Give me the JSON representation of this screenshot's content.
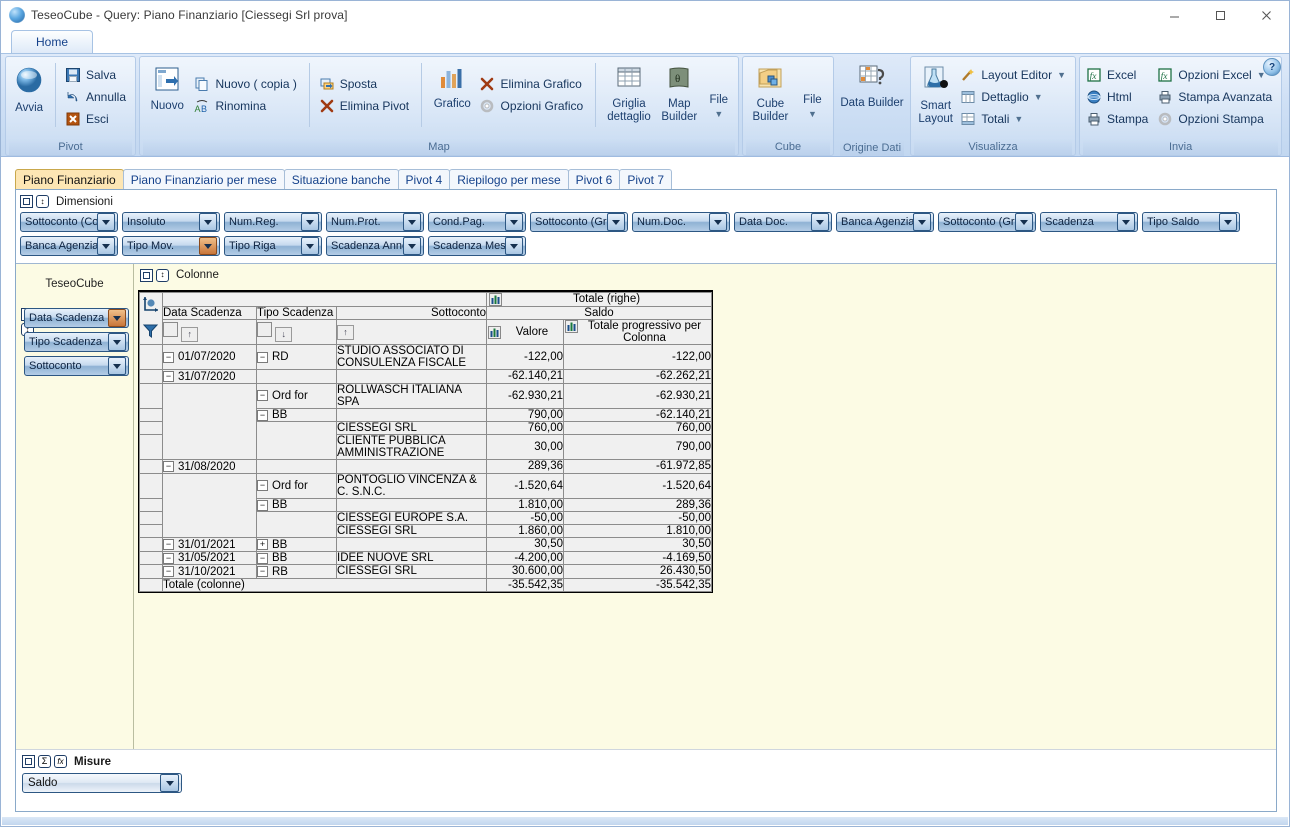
{
  "window": {
    "title": "TeseoCube - Query: Piano Finanziario [Ciessegi Srl prova]",
    "minimize": "minimize",
    "maximize": "maximize",
    "close": "close",
    "help": "?"
  },
  "ribbon": {
    "tabs": [
      {
        "label": "Home"
      }
    ],
    "groups": [
      {
        "name": "Pivot",
        "label": "Pivot",
        "big": [
          {
            "label": "Avvia",
            "icon": "sphere-icon"
          }
        ],
        "small": [
          {
            "label": "Salva",
            "icon": "save-icon"
          },
          {
            "label": "Annulla",
            "icon": "undo-icon"
          },
          {
            "label": "Esci",
            "icon": "exit-icon"
          }
        ]
      },
      {
        "name": "Map",
        "label": "Map",
        "big": [
          {
            "label": "Nuovo",
            "icon": "new-pivot-icon"
          }
        ],
        "small": [
          {
            "label": "Nuovo ( copia )",
            "icon": "copy-icon"
          },
          {
            "label": "Rinomina",
            "icon": "rename-icon"
          }
        ],
        "small2": [
          {
            "label": "Sposta",
            "icon": "move-icon"
          },
          {
            "label": "Elimina Pivot",
            "icon": "delete-icon"
          }
        ],
        "big2": [
          {
            "label": "Grafico",
            "icon": "chart-icon"
          }
        ],
        "small3": [
          {
            "label": "Elimina Grafico",
            "icon": "delete-icon"
          },
          {
            "label": "Opzioni Grafico",
            "icon": "gear-icon"
          }
        ],
        "big3": [
          {
            "label": "Griglia dettaglio",
            "icon": "grid-icon"
          },
          {
            "label": "Map Builder",
            "icon": "map-builder-icon"
          },
          {
            "label": "File",
            "icon": "file-dropdown-icon",
            "dropdown": true
          }
        ]
      },
      {
        "name": "Cube",
        "label": "Cube",
        "big": [
          {
            "label": "Cube Builder",
            "icon": "cube-builder-icon"
          },
          {
            "label": "File",
            "icon": "file-dropdown-icon",
            "dropdown": true
          }
        ]
      },
      {
        "name": "Origine Dati",
        "label": "Origine Dati",
        "big": [
          {
            "label": "Data Builder",
            "icon": "data-builder-icon"
          }
        ]
      },
      {
        "name": "Visualizza",
        "label": "Visualizza",
        "big": [
          {
            "label": "Smart Layout",
            "icon": "smart-layout-icon"
          }
        ],
        "small": [
          {
            "label": "Layout Editor",
            "icon": "wand-icon",
            "dropdown": true
          },
          {
            "label": "Dettaglio",
            "icon": "detail-icon",
            "dropdown": true
          },
          {
            "label": "Totali",
            "icon": "totals-icon",
            "dropdown": true
          }
        ]
      },
      {
        "name": "Invia",
        "label": "Invia",
        "small": [
          {
            "label": "Excel",
            "icon": "excel-icon"
          },
          {
            "label": "Html",
            "icon": "html-icon"
          },
          {
            "label": "Stampa",
            "icon": "print-icon"
          }
        ],
        "small2": [
          {
            "label": "Opzioni Excel",
            "icon": "excel-icon",
            "dropdown": true
          },
          {
            "label": "Stampa Avanzata",
            "icon": "print-icon"
          },
          {
            "label": "Opzioni Stampa",
            "icon": "gear-icon"
          }
        ]
      }
    ]
  },
  "pivot_tabs": [
    {
      "label": "Piano Finanziario",
      "active": true
    },
    {
      "label": "Piano Finanziario per mese",
      "active": false
    },
    {
      "label": "Situazione banche",
      "active": false
    },
    {
      "label": "Pivot 4",
      "active": false
    },
    {
      "label": "Riepilogo per mese",
      "active": false
    },
    {
      "label": "Pivot 6",
      "active": false
    },
    {
      "label": "Pivot 7",
      "active": false
    }
  ],
  "dimensions": {
    "header": "Dimensioni",
    "row1": [
      {
        "label": "Sottoconto (Cod",
        "highlight": false
      },
      {
        "label": "Insoluto",
        "highlight": false
      },
      {
        "label": "Num.Reg.",
        "highlight": false
      },
      {
        "label": "Num.Prot.",
        "highlight": false
      },
      {
        "label": "Cond.Pag.",
        "highlight": false
      },
      {
        "label": "Sottoconto (Grp",
        "highlight": false
      },
      {
        "label": "Num.Doc.",
        "highlight": false
      },
      {
        "label": "Data Doc.",
        "highlight": false
      },
      {
        "label": "Banca Agenzia",
        "highlight": false
      },
      {
        "label": "Sottoconto (Grp",
        "highlight": false
      },
      {
        "label": "Scadenza",
        "highlight": false
      },
      {
        "label": "Tipo Saldo",
        "highlight": false
      }
    ],
    "row2": [
      {
        "label": "Banca Agenzia",
        "highlight": false
      },
      {
        "label": "Tipo Mov.",
        "highlight": true
      },
      {
        "label": "Tipo Riga",
        "highlight": false
      },
      {
        "label": "Scadenza Anno",
        "highlight": false
      },
      {
        "label": "Scadenza Mese",
        "highlight": false
      }
    ]
  },
  "columns_header": "Colonne",
  "cube_name": "TeseoCube",
  "row_dimensions": [
    {
      "label": "Data Scadenza",
      "highlight": true
    },
    {
      "label": "Tipo Scadenza",
      "highlight": false
    },
    {
      "label": "Sottoconto",
      "highlight": false
    }
  ],
  "grid": {
    "total_rows_label": "Totale (righe)",
    "measure_group": "Saldo",
    "col_headers": [
      "Data Scadenza",
      "Tipo Scadenza",
      "Sottoconto"
    ],
    "value_headers": [
      "Valore",
      "Totale progressivo per Colonna"
    ],
    "total_col_label": "Totale (colonne)",
    "total_values": [
      "-35.542,35",
      "-35.542,35"
    ],
    "rows": [
      {
        "level": 0,
        "date": "01/07/2020",
        "type": "RD",
        "account": "STUDIO ASSOCIATO DI CONSULENZA FISCALE",
        "valore": "-122,00",
        "progressivo": "-122,00",
        "expandable": true,
        "expand_state": "minus",
        "two_line": true
      },
      {
        "level": 0,
        "date": "31/07/2020",
        "type": "",
        "account": "",
        "valore": "-62.140,21",
        "progressivo": "-62.262,21",
        "expandable": true,
        "expand_state": "minus",
        "two_line": false
      },
      {
        "level": 1,
        "date": "",
        "type": "Ord for",
        "account": "ROLLWASCH ITALIANA SPA",
        "valore": "-62.930,21",
        "progressivo": "-62.930,21",
        "expandable": true,
        "expand_state": "minus",
        "two_line": false
      },
      {
        "level": 1,
        "date": "",
        "type": "BB",
        "account": "",
        "valore": "790,00",
        "progressivo": "-62.140,21",
        "expandable": true,
        "expand_state": "minus",
        "two_line": false
      },
      {
        "level": 2,
        "date": "",
        "type": "",
        "account": "CIESSEGI SRL",
        "valore": "760,00",
        "progressivo": "760,00",
        "expandable": false,
        "expand_state": "",
        "two_line": false
      },
      {
        "level": 2,
        "date": "",
        "type": "",
        "account": "CLIENTE PUBBLICA AMMINISTRAZIONE",
        "valore": "30,00",
        "progressivo": "790,00",
        "expandable": false,
        "expand_state": "",
        "two_line": true
      },
      {
        "level": 0,
        "date": "31/08/2020",
        "type": "",
        "account": "",
        "valore": "289,36",
        "progressivo": "-61.972,85",
        "expandable": true,
        "expand_state": "minus",
        "two_line": false
      },
      {
        "level": 1,
        "date": "",
        "type": "Ord for",
        "account": "PONTOGLIO VINCENZA & C. S.N.C.",
        "valore": "-1.520,64",
        "progressivo": "-1.520,64",
        "expandable": true,
        "expand_state": "minus",
        "two_line": true
      },
      {
        "level": 1,
        "date": "",
        "type": "BB",
        "account": "",
        "valore": "1.810,00",
        "progressivo": "289,36",
        "expandable": true,
        "expand_state": "minus",
        "two_line": false
      },
      {
        "level": 2,
        "date": "",
        "type": "",
        "account": "CIESSEGI EUROPE S.A.",
        "valore": "-50,00",
        "progressivo": "-50,00",
        "expandable": false,
        "expand_state": "",
        "two_line": false
      },
      {
        "level": 2,
        "date": "",
        "type": "",
        "account": "CIESSEGI SRL",
        "valore": "1.860,00",
        "progressivo": "1.810,00",
        "expandable": false,
        "expand_state": "",
        "two_line": false
      },
      {
        "level": 0,
        "date": "31/01/2021",
        "type": "BB",
        "account": "",
        "valore": "30,50",
        "progressivo": "30,50",
        "expandable": true,
        "expand_state": "plus",
        "two_line": false
      },
      {
        "level": 0,
        "date": "31/05/2021",
        "type": "BB",
        "account": "IDEE NUOVE SRL",
        "valore": "-4.200,00",
        "progressivo": "-4.169,50",
        "expandable": true,
        "expand_state": "minus",
        "two_line": false
      },
      {
        "level": 0,
        "date": "31/10/2021",
        "type": "RB",
        "account": "CIESSEGI SRL",
        "valore": "30.600,00",
        "progressivo": "26.430,50",
        "expandable": true,
        "expand_state": "minus",
        "two_line": false
      }
    ]
  },
  "measures": {
    "header": "Misure",
    "selected": "Saldo"
  },
  "colors": {
    "ribbon_bg": "#cfe0f5",
    "active_tab": "#fde6b4",
    "pane_bg": "#fcfbe4",
    "grid_bg": "#f0f0f0",
    "pill_border": "#2d5783",
    "highlight_orange": "#c9763a"
  }
}
